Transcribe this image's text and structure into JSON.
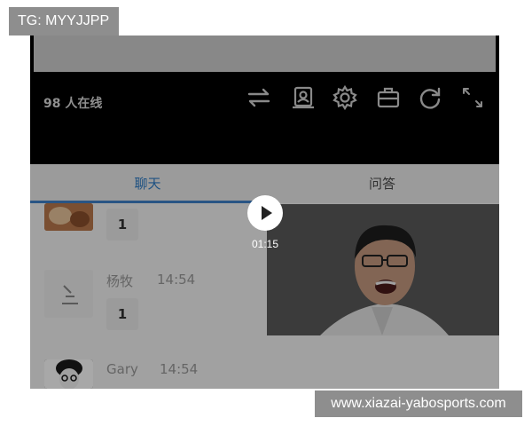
{
  "watermarks": {
    "top_left": "TG: MYYJJPP",
    "bottom_right": "www.xiazai-yabosports.com"
  },
  "live": {
    "online_count": "98 人在线",
    "controls": [
      "switch-icon",
      "playlist-icon",
      "settings-icon",
      "briefcase-icon",
      "refresh-icon",
      "fullscreen-icon"
    ]
  },
  "tabs": [
    {
      "label": "聊天",
      "active": true
    },
    {
      "label": "问答",
      "active": false
    }
  ],
  "chat": {
    "messages": [
      {
        "name": "",
        "time": "",
        "count": "1"
      },
      {
        "name": "杨牧",
        "time": "14:54",
        "count": "1"
      },
      {
        "name": "Gary",
        "time": "14:54",
        "count": ""
      }
    ]
  },
  "video": {
    "duration": "01:15",
    "play_icon": "play-icon"
  },
  "colors": {
    "accent": "#3f82c9",
    "watermark_bg": "#8e8e8e",
    "player_bg": "#000000"
  }
}
